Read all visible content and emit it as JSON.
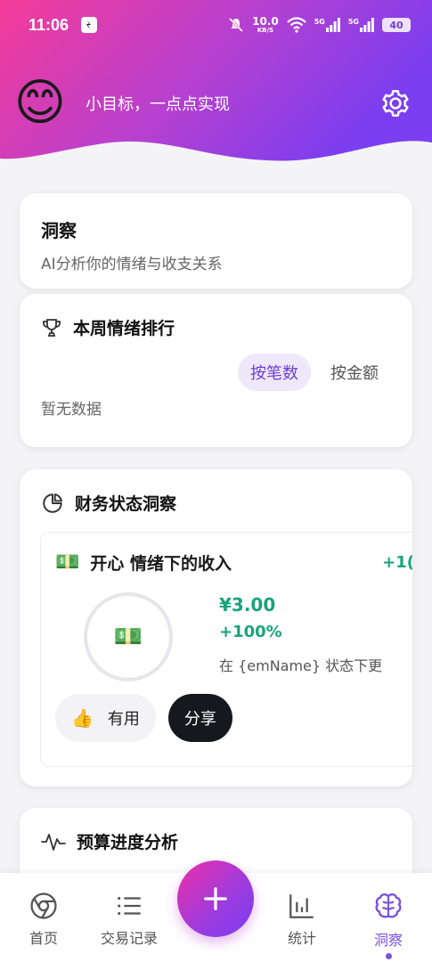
{
  "status_bar": {
    "time": "11:06",
    "net_speed_value": "10.0",
    "net_speed_unit": "KB/S",
    "signal_1": "5G",
    "signal_2": "5G",
    "battery": "40"
  },
  "header": {
    "avatar_emoji": "😊",
    "motto": "小目标，一点点实现"
  },
  "insight_card": {
    "title": "洞察",
    "subtitle": "AI分析你的情绪与收支关系"
  },
  "ranking_card": {
    "title": "本周情绪排行",
    "toggle_count": "按笔数",
    "toggle_amount": "按金额",
    "empty": "暂无数据"
  },
  "finance_card": {
    "title": "财务状态洞察",
    "item": {
      "emoji": "💵",
      "title": "开心 情绪下的收入",
      "pct_top": "+1(",
      "ring_emoji": "💵",
      "amount": "¥3.00",
      "pct": "+100%",
      "desc": "在 {emName} 状态下更",
      "useful_icon": "👍",
      "useful_label": "有用",
      "share_label": "分享"
    }
  },
  "budget_card": {
    "title": "预算进度分析"
  },
  "nav": {
    "home": "首页",
    "transactions": "交易记录",
    "stats": "统计",
    "insights": "洞察"
  },
  "colors": {
    "gradient_start": "#f0379a",
    "gradient_end": "#7b3ef0",
    "accent": "#7b53df",
    "income_green": "#1aa37a"
  }
}
